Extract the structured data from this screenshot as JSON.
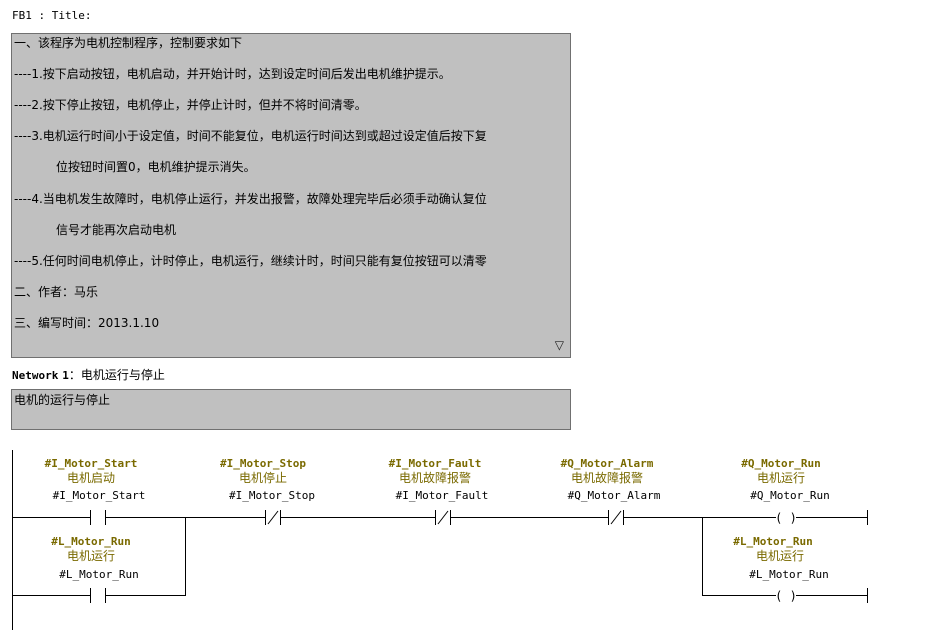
{
  "block_header": "FB1 : Title:",
  "block_comment": {
    "lines": [
      "一、该程序为电机控制程序，控制要求如下",
      "----1.按下启动按钮，电机启动，并开始计时，达到设定时间后发出电机维护提示。",
      "----2.按下停止按钮，电机停止，并停止计时，但并不将时间清零。",
      "----3.电机运行时间小于设定值，时间不能复位，电机运行时间达到或超过设定值后按下复",
      "位按钮时间置0，电机维护提示消失。",
      "----4.当电机发生故障时，电机停止运行，并发出报警，故障处理完毕后必须手动确认复位",
      "信号才能再次启动电机",
      "----5.任何时间电机停止，计时停止，电机运行，继续计时，时间只能有复位按钮可以清零",
      "二、作者：马乐",
      "三、编写时间：2013.1.10"
    ],
    "scroll_icon": "▽"
  },
  "network": {
    "label": "Network",
    "number": "1",
    "separator": "：",
    "title": "电机运行与停止",
    "comment": "电机的运行与停止"
  },
  "rung": {
    "contacts": [
      {
        "symbol": "#I_Motor_Start",
        "comment": "电机启动",
        "address": "#I_Motor_Start",
        "type": "NO"
      },
      {
        "symbol": "#I_Motor_Stop",
        "comment": "电机停止",
        "address": "#I_Motor_Stop",
        "type": "NC"
      },
      {
        "symbol": "#I_Motor_Fault",
        "comment": "电机故障报警",
        "address": "#I_Motor_Fault",
        "type": "NC"
      },
      {
        "symbol": "#Q_Motor_Alarm",
        "comment": "电机故障报警",
        "address": "#Q_Motor_Alarm",
        "type": "NC"
      }
    ],
    "branch_contact": {
      "symbol": "#L_Motor_Run",
      "comment": "电机运行",
      "address": "#L_Motor_Run",
      "type": "NO"
    },
    "coils": [
      {
        "symbol": "#Q_Motor_Run",
        "comment": "电机运行",
        "address": "#Q_Motor_Run",
        "glyph": "( )"
      },
      {
        "symbol": "#L_Motor_Run",
        "comment": "电机运行",
        "address": "#L_Motor_Run",
        "glyph": "( )"
      }
    ]
  }
}
